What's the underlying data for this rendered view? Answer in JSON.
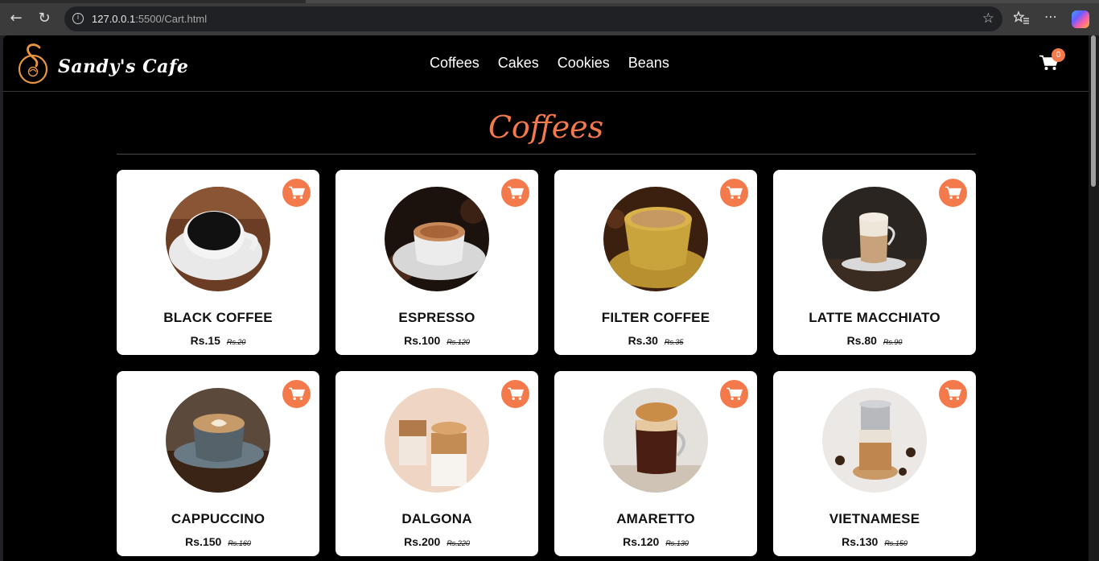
{
  "browser": {
    "url_host": "127.0.0.1",
    "url_rest": ":5500/Cart.html",
    "back_icon": "arrow-left-icon",
    "reload_icon": "reload-icon"
  },
  "header": {
    "brand": "Sandy's Cafe",
    "nav": [
      "Coffees",
      "Cakes",
      "Cookies",
      "Beans"
    ],
    "cart_count": "0"
  },
  "section": {
    "title": "Coffees"
  },
  "colors": {
    "accent": "#f47a4b",
    "card": "#ffffff",
    "page": "#000000"
  },
  "products": [
    {
      "name": "BLACK COFFEE",
      "price": "Rs.15",
      "old_price": "Rs.20"
    },
    {
      "name": "ESPRESSO",
      "price": "Rs.100",
      "old_price": "Rs.120"
    },
    {
      "name": "FILTER COFFEE",
      "price": "Rs.30",
      "old_price": "Rs.35"
    },
    {
      "name": "LATTE MACCHIATO",
      "price": "Rs.80",
      "old_price": "Rs.90"
    },
    {
      "name": "CAPPUCCINO",
      "price": "Rs.150",
      "old_price": "Rs.160"
    },
    {
      "name": "DALGONA",
      "price": "Rs.200",
      "old_price": "Rs.220"
    },
    {
      "name": "AMARETTO",
      "price": "Rs.120",
      "old_price": "Rs.130"
    },
    {
      "name": "VIETNAMESE",
      "price": "Rs.130",
      "old_price": "Rs.150"
    }
  ]
}
